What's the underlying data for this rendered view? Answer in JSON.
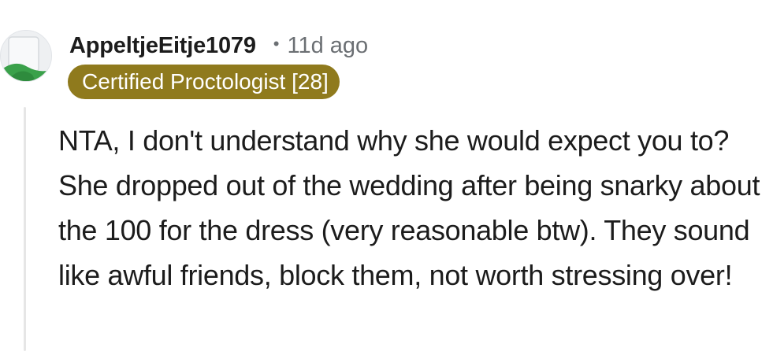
{
  "comment": {
    "author": "AppeltjeEitje1079",
    "separator": "•",
    "timestamp": "11d ago",
    "flair": "Certified Proctologist [28]",
    "body": "NTA, I don't understand why she would expect you to? She dropped out of the wedding after being snarky about the 100 for the dress (very reasonable btw). They sound like awful friends, block them, not worth stressing over!"
  },
  "avatar": {
    "icon": "default-avatar-icon"
  },
  "colors": {
    "flair_background": "#8f7a1d",
    "flair_text": "#ffffff",
    "username": "#1c1c1c",
    "meta": "#6b6f73",
    "body": "#1c1c1c",
    "thread_line": "#e6e6e6"
  }
}
